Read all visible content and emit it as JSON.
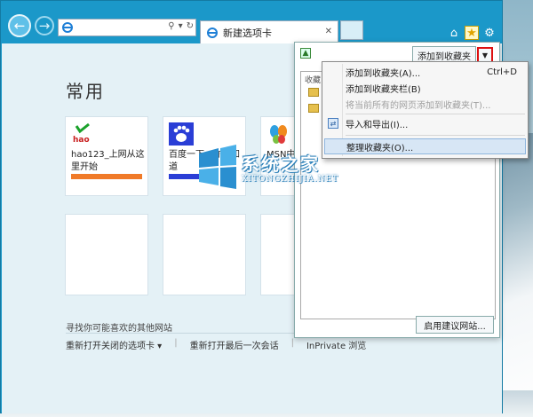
{
  "tab": {
    "title": "新建选项卡"
  },
  "page": {
    "heading": "常用",
    "tiles": [
      {
        "label": "hao123_上网从这里开始",
        "logo_text": "hao",
        "bar_color": "#f07a28"
      },
      {
        "label": "百度一下，你就知道",
        "logo_text": "",
        "bar_color": "#2a3ed6"
      },
      {
        "label": "MSN中",
        "logo_text": "",
        "bar_color": ""
      }
    ],
    "find_sites": "寻找你可能喜欢的其他网站",
    "links": [
      "重新打开关闭的选项卡 ▾",
      "重新打开最后一次会话",
      "InPrivate 浏览"
    ]
  },
  "favorites": {
    "add_button": "添加到收藏夹",
    "tab_label": "收藏",
    "suggest_button": "启用建议网站..."
  },
  "menu": {
    "items": [
      {
        "label": "添加到收藏夹(A)...",
        "shortcut": "Ctrl+D",
        "disabled": false
      },
      {
        "label": "添加到收藏夹栏(B)",
        "shortcut": "",
        "disabled": false
      },
      {
        "label": "将当前所有的网页添加到收藏夹(T)...",
        "shortcut": "",
        "disabled": true
      },
      {
        "label": "导入和导出(I)...",
        "shortcut": "",
        "disabled": false
      },
      {
        "label": "整理收藏夹(O)...",
        "shortcut": "",
        "disabled": false
      }
    ]
  },
  "watermark": {
    "title": "系统之家",
    "subtitle": "XITONGZHIJIA.NET"
  },
  "colors": {
    "window": "#1b98c9",
    "accent_red": "#d11",
    "hover": "#d7e6f5"
  },
  "icons": [
    "back-arrow-icon",
    "forward-arrow-icon",
    "ie-logo-icon",
    "search-icon",
    "refresh-icon",
    "home-icon",
    "star-icon",
    "gear-icon",
    "close-icon",
    "folder-icon",
    "import-export-icon",
    "pin-icon",
    "chevron-down-icon"
  ]
}
